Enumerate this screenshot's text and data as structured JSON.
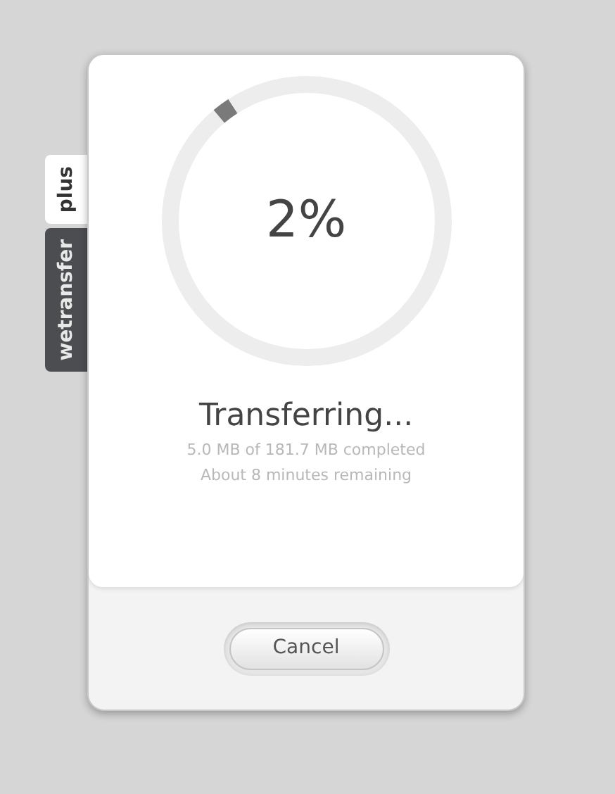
{
  "side_tabs": [
    {
      "label": "plus",
      "selected": true
    },
    {
      "label": "wetransfer",
      "selected": false
    }
  ],
  "progress": {
    "level": 0.02,
    "percent": "2%"
  },
  "status": {
    "title": "Transferring...",
    "detail": "5.0 MB of 181.7 MB completed",
    "remaining": "About 8 minutes remaining"
  },
  "buttons": [
    "Cancel"
  ]
}
